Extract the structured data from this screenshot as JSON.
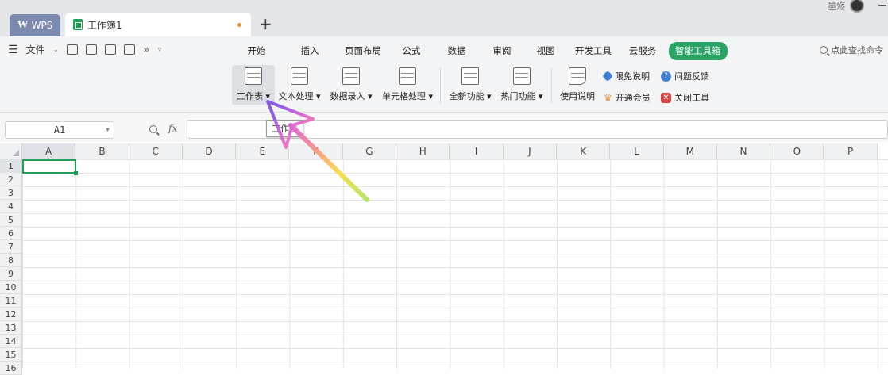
{
  "titlebar": {
    "app_tab": "WPS",
    "app_logo": "W",
    "doc_tab": "工作簿1",
    "new_tab": "+",
    "user_name": "墨殇"
  },
  "menu": {
    "file": "文件",
    "more": "»",
    "tabs": [
      "开始",
      "插入",
      "页面布局",
      "公式",
      "数据",
      "审阅",
      "视图",
      "开发工具",
      "云服务",
      "智能工具箱"
    ],
    "active_tab": "智能工具箱",
    "search": "点此查找命令"
  },
  "ribbon": {
    "buttons": [
      "工作表",
      "文本处理",
      "数据录入",
      "单元格处理",
      "全新功能",
      "热门功能",
      "使用说明"
    ],
    "side_links": [
      "限免说明",
      "问题反馈",
      "开通会员",
      "关闭工具"
    ]
  },
  "formula": {
    "name_box": "A1",
    "fx": "fx",
    "tooltip": "工作表"
  },
  "grid": {
    "columns": [
      "A",
      "B",
      "C",
      "D",
      "E",
      "F",
      "G",
      "H",
      "I",
      "J",
      "K",
      "L",
      "M",
      "N",
      "O",
      "P"
    ],
    "rows": [
      "1",
      "2",
      "3",
      "4",
      "5",
      "6",
      "7",
      "8",
      "9",
      "10",
      "11",
      "12",
      "13",
      "14",
      "15",
      "16"
    ],
    "selected_cell": "A1"
  },
  "colors": {
    "accent_green": "#2aa364",
    "wps_tab": "#7d8ab0",
    "arrow": "#9b5de5"
  }
}
